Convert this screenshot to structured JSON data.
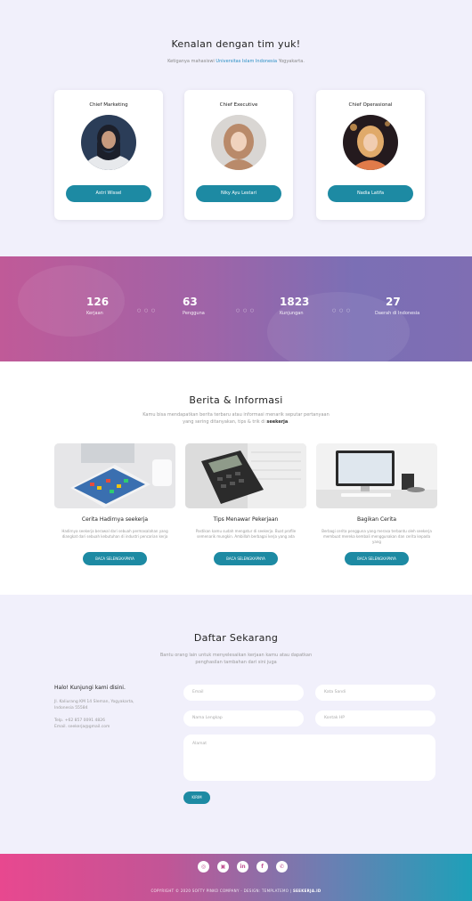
{
  "team": {
    "title": "Kenalan dengan tim yuk!",
    "subtitle_pre": "Ketiganya mahasiswi",
    "subtitle_uni": "Universitas Islam Indonesia",
    "subtitle_post": "Yogyakarta.",
    "members": [
      {
        "role": "Chief Marketing",
        "name": "Astri Wissel"
      },
      {
        "role": "Chief Executive",
        "name": "Niky Ayu Lestari"
      },
      {
        "role": "Chief Operasional",
        "name": "Nadia Latifa"
      }
    ]
  },
  "stats": [
    {
      "value": "126",
      "label": "Kerjaan"
    },
    {
      "value": "63",
      "label": "Pengguna"
    },
    {
      "value": "1823",
      "label": "Kunjungan"
    },
    {
      "value": "27",
      "label": "Daerah di Indonesia"
    }
  ],
  "news": {
    "title": "Berita & Informasi",
    "subtitle": "Kamu bisa mendapatkan berita terbaru atau informasi menarik seputar pertanyaan yang sering ditanyakan, tips & trik di",
    "subtitle_brand": "seekerja",
    "items": [
      {
        "title": "Cerita Hadirnya seekerja",
        "text": "Hadirnya seekerja berawal dari sebuah permasalahan yang diangkat dari sebuah kebutuhan di industri pencarian kerja",
        "button": "BACA SELENGKAPNYA"
      },
      {
        "title": "Tips Menawar Pekerjaan",
        "text": "Pastikan kamu sudah mengatur di seekerja. Buat profile semenarik mungkin. Ambillah berbagai kerja yang ada",
        "button": "BACA SELENGKAPNYA"
      },
      {
        "title": "Bagikan Cerita",
        "text": "Berbagi cerita pengguna yang merasa terbantu oleh seekerja membuat mereka kembali menggunakan dan cerita kepada yang",
        "button": "BACA SELENGKAPNYA"
      }
    ]
  },
  "form": {
    "title": "Daftar Sekarang",
    "subtitle": "Bantu orang lain untuk menyelesaikan kerjaan kamu atau dapatkan penghasilan tambahan dari sini juga",
    "contact_heading": "Halo! Kunjungi kami disini.",
    "address": "Jl. Kaliurang KM 14 Sleman, Yogyakarta, Indonesia 55584",
    "phone": "Telp. +62 857 0091 4826",
    "email": "Email. seekerja@gmail.com",
    "placeholders": {
      "email": "Email",
      "password": "Kata Sandi",
      "name": "Nama Lengkap",
      "phone": "Kontak HP",
      "address": "Alamat"
    },
    "submit": "KIRIM"
  },
  "footer": {
    "copyright": "COPYRIGHT © 2020 SOFTY PINKO COMPANY - DESIGN: TEMPLATEMO |",
    "brand": "SEEKERJA.ID",
    "icons": [
      "whatsapp-icon",
      "instagram-icon",
      "linkedin-icon",
      "facebook-icon",
      "phone-icon"
    ]
  },
  "colors": {
    "accent": "#1d8aa3",
    "pink": "#e8488f",
    "stats_bg": "#9e64a8"
  }
}
